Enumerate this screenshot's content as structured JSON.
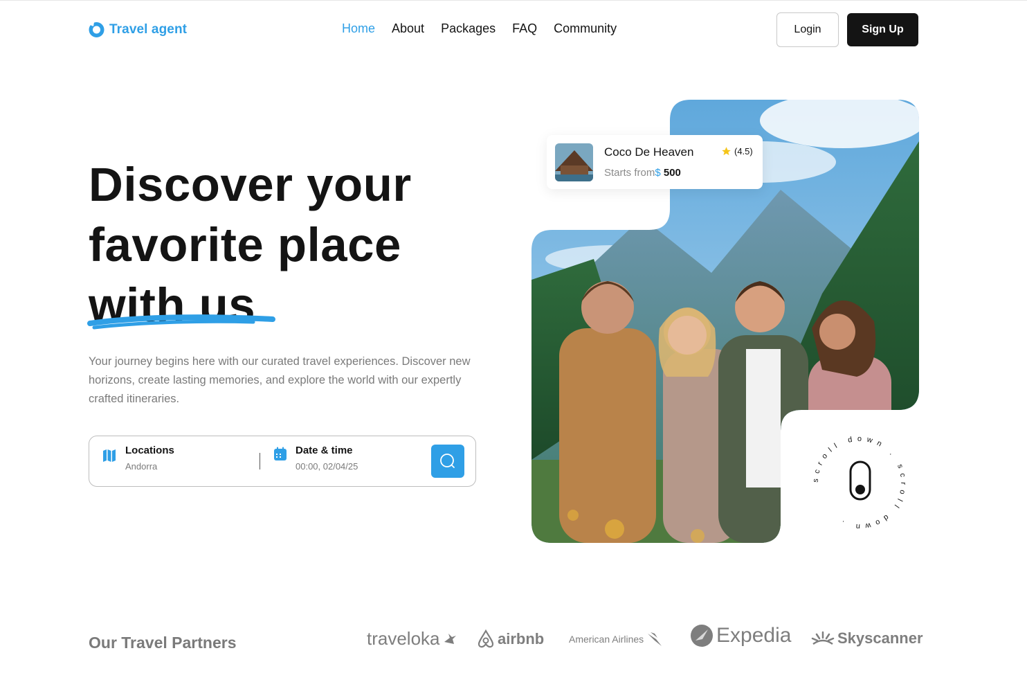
{
  "nav": {
    "logo_text": "Travel agent",
    "items": [
      {
        "label": "Home",
        "active": true
      },
      {
        "label": "About",
        "active": false
      },
      {
        "label": "Packages",
        "active": false
      },
      {
        "label": "FAQ",
        "active": false
      },
      {
        "label": "Community",
        "active": false
      }
    ],
    "login_label": "Login",
    "signup_label": "Sign Up"
  },
  "hero": {
    "headline_lines": [
      "Discover your",
      "favorite place",
      "with us"
    ],
    "description": "Your journey begins here with our curated travel experiences. Discover new horizons, create lasting memories, and explore the world with our expertly crafted itineraries."
  },
  "search": {
    "location_label": "Locations",
    "location_value": "Andorra",
    "date_label": "Date & time",
    "date_value": "00:00, 02/04/25",
    "search_icon": "search-icon"
  },
  "card": {
    "title": "Coco De Heaven",
    "price_prefix": "Starts from",
    "currency": "$",
    "price": " 500",
    "rating": "(4.5)"
  },
  "scroll_badge": {
    "text": "scroll down . scroll down . "
  },
  "partners": {
    "title": "Our Travel Partners",
    "items": [
      "traveloka",
      "airbnb",
      "American Airlines",
      "Expedia",
      "Skyscanner"
    ]
  },
  "colors": {
    "accent": "#2f9fe6",
    "dark": "#141414",
    "muted": "#7a7a7a",
    "star": "#f5c518"
  }
}
